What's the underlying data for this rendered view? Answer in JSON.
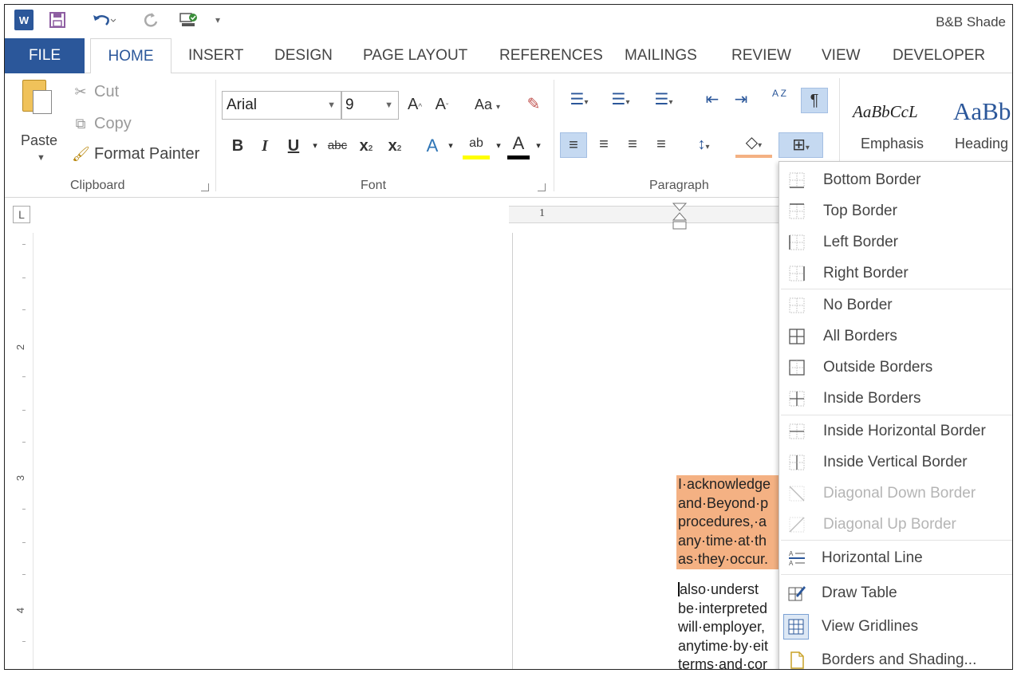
{
  "window": {
    "title": "B&B Shade"
  },
  "tabs": [
    "FILE",
    "HOME",
    "INSERT",
    "DESIGN",
    "PAGE LAYOUT",
    "REFERENCES",
    "MAILINGS",
    "REVIEW",
    "VIEW",
    "DEVELOPER"
  ],
  "clipboard": {
    "paste": "Paste",
    "cut": "Cut",
    "copy": "Copy",
    "format_painter": "Format Painter",
    "group": "Clipboard"
  },
  "font": {
    "name": "Arial",
    "size": "9",
    "change_case": "Aa",
    "bold": "B",
    "italic": "I",
    "underline": "U",
    "strikethrough": "abc",
    "subscript": "x",
    "superscript": "x",
    "highlight_glyph": "ab",
    "font_color_glyph": "A",
    "group": "Font"
  },
  "paragraph": {
    "group": "Paragraph",
    "sort": "A Z",
    "pilcrow": "¶"
  },
  "styles": {
    "items": [
      {
        "sample": "AaBbCcL",
        "name": "Emphasis"
      },
      {
        "sample": "AaBb",
        "name": "Heading"
      }
    ]
  },
  "ruler": {
    "h_number": "1",
    "v_numbers": [
      "2",
      "3",
      "4"
    ],
    "corner": "L"
  },
  "document": {
    "para1_lines": [
      "I·acknowledge",
      "and·Beyond·p",
      "procedures,·a",
      "any·time·at·th",
      "as·they·occur."
    ],
    "para2_lines": [
      "also·underst",
      "be·interpreted",
      "will·employer,",
      "anytime·by·eit",
      "terms·and·cor"
    ]
  },
  "borders_menu": [
    {
      "label": "Bottom Border",
      "icon": "bottom-border-icon",
      "enabled": true
    },
    {
      "label": "Top Border",
      "icon": "top-border-icon",
      "enabled": true
    },
    {
      "label": "Left Border",
      "icon": "left-border-icon",
      "enabled": true
    },
    {
      "label": "Right Border",
      "icon": "right-border-icon",
      "enabled": true
    },
    {
      "label": "No Border",
      "icon": "no-border-icon",
      "enabled": true
    },
    {
      "label": "All Borders",
      "icon": "all-borders-icon",
      "enabled": true
    },
    {
      "label": "Outside Borders",
      "icon": "outside-borders-icon",
      "enabled": true
    },
    {
      "label": "Inside Borders",
      "icon": "inside-borders-icon",
      "enabled": true
    },
    {
      "label": "Inside Horizontal Border",
      "icon": "inside-horizontal-border-icon",
      "enabled": true
    },
    {
      "label": "Inside Vertical Border",
      "icon": "inside-vertical-border-icon",
      "enabled": true
    },
    {
      "label": "Diagonal Down Border",
      "icon": "diagonal-down-border-icon",
      "enabled": false
    },
    {
      "label": "Diagonal Up Border",
      "icon": "diagonal-up-border-icon",
      "enabled": false
    },
    {
      "label": "Horizontal Line",
      "icon": "horizontal-line-icon",
      "enabled": true
    },
    {
      "label": "Draw Table",
      "icon": "draw-table-icon",
      "enabled": true
    },
    {
      "label": "View Gridlines",
      "icon": "view-gridlines-icon",
      "enabled": true
    },
    {
      "label": "Borders and Shading...",
      "icon": "borders-and-shading-icon",
      "enabled": true
    }
  ],
  "colors": {
    "accent": "#2b579a",
    "highlight": "#f4b183",
    "selected_button": "#c5d9f1"
  }
}
